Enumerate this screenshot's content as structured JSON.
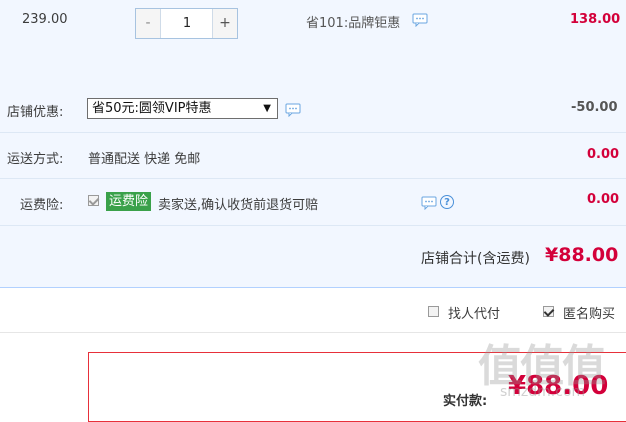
{
  "item": {
    "unit_price": "239.00",
    "quantity": "1",
    "minus_label": "-",
    "plus_label": "+",
    "promo_text": "省101:品牌钜惠",
    "subtotal": "138.00"
  },
  "shop_discount": {
    "label": "店铺优惠:",
    "selected_option": "省50元:圆领VIP特惠",
    "amount": "-50.00"
  },
  "shipping": {
    "label": "运送方式:",
    "text": "普通配送 快递 免邮",
    "amount": "0.00"
  },
  "shipping_insurance": {
    "label": "运费险:",
    "checked": true,
    "badge": "运费险",
    "text": "卖家送,确认收货前退货可赔",
    "amount": "0.00",
    "help": "?"
  },
  "shop_total": {
    "label": "店铺合计(含运费)",
    "amount": "¥88.00"
  },
  "options": {
    "pay_for_me_label": "找人代付",
    "pay_for_me_checked": false,
    "anonymous_label": "匿名购买",
    "anonymous_checked": true
  },
  "payment": {
    "label": "实付款:",
    "amount": "¥88.00"
  },
  "colors": {
    "panel_bg": "#f2f7ff",
    "accent_red": "#d3003a",
    "badge_green": "#3aa14a",
    "link_blue": "#4a90d9"
  }
}
